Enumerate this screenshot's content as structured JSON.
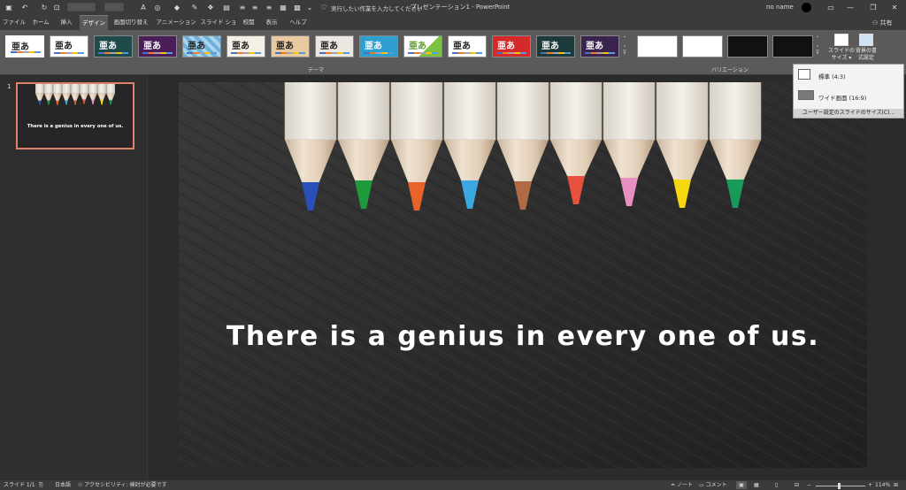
{
  "titlebar": {
    "doc_title": "プレゼンテーション1  -  PowerPoint",
    "user_name": "no name",
    "share": "共有",
    "tell_me": "実行したい作業を入力してください"
  },
  "tabs": [
    "ファイル",
    "ホーム",
    "挿入",
    "デザイン",
    "画面切り替え",
    "アニメーション",
    "スライド ショー",
    "校閲",
    "表示",
    "ヘルプ"
  ],
  "ribbon": {
    "themes_group_label": "テーマ",
    "variants_group_label": "バリエーション",
    "theme_glyph": "亜あ",
    "slide_size_label": "スライドの\nサイズ ▾",
    "format_bg_label": "背景の書\n式設定"
  },
  "slide_size_menu": {
    "standard": "標準 (4:3)",
    "widescreen": "ワイド画面 (16:9)",
    "custom": "ユーザー設定のスライドのサイズ(C)..."
  },
  "slide": {
    "number": "1",
    "text": "There is a genius in every one of us."
  },
  "status": {
    "slide_count": "スライド 1/1",
    "language": "日本語",
    "accessibility": "アクセシビリティ: 検討が必要です",
    "notes": "ノート",
    "comments": "コメント",
    "zoom": "114%"
  },
  "colors": {
    "accent": "#e0816a",
    "pencils": [
      "#2a4fb8",
      "#1e9a3c",
      "#e8632a",
      "#3aa7e0",
      "#b06b45",
      "#e8503e",
      "#e88fc3",
      "#f5d80f",
      "#1a9a5a"
    ]
  }
}
